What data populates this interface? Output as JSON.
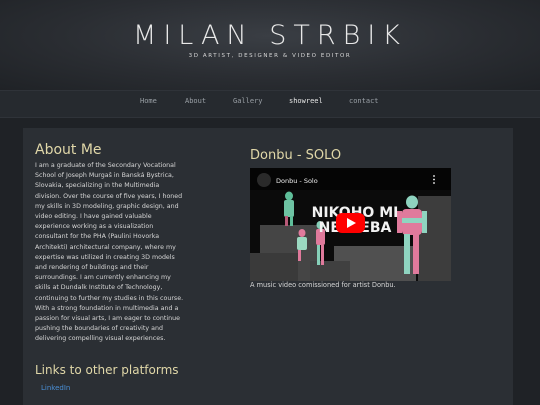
{
  "header": {
    "logo": "MILAN STRBIK",
    "tagline": "3D ARTIST, DESIGNER & VIDEO EDITOR"
  },
  "nav": {
    "items": [
      {
        "label": "Home"
      },
      {
        "label": "About"
      },
      {
        "label": "Gallery"
      },
      {
        "label": "showreel"
      },
      {
        "label": "contact"
      }
    ]
  },
  "about": {
    "title": "About Me",
    "text": "I am a graduate of the Secondary Vocational School of Joseph Murgaš in Banská Bystrica, Slovakia, specializing in the Multimedia division. Over the course of five years, I honed my skills in 3D modeling, graphic design, and video editing. I have gained valuable experience working as a visualization consultant for the PHA (Paulini Hovorka Architekti) architectural company, where my expertise was utilized in creating 3D models and rendering of buildings and their surroundings. I am currently enhancing my skills at Dundalk Institute of Technology, continuing to further my studies in this course. With a strong foundation in multimedia and a passion for visual arts, I am eager to continue pushing the boundaries of creativity and delivering compelling visual experiences."
  },
  "links": {
    "title": "Links to other platforms",
    "items": [
      {
        "label": "LinkedIn"
      }
    ]
  },
  "video": {
    "title": "Donbu - SOLO",
    "embed_title": "Donbu - Solo",
    "overlay_text_line1": "NIKOHO MI",
    "overlay_text_line2": "NETREBA",
    "caption": "A music video comissioned for artist Donbu."
  },
  "colors": {
    "heading": "#e0d7a8",
    "link": "#4a8fd6",
    "play_button": "#ff0000"
  }
}
